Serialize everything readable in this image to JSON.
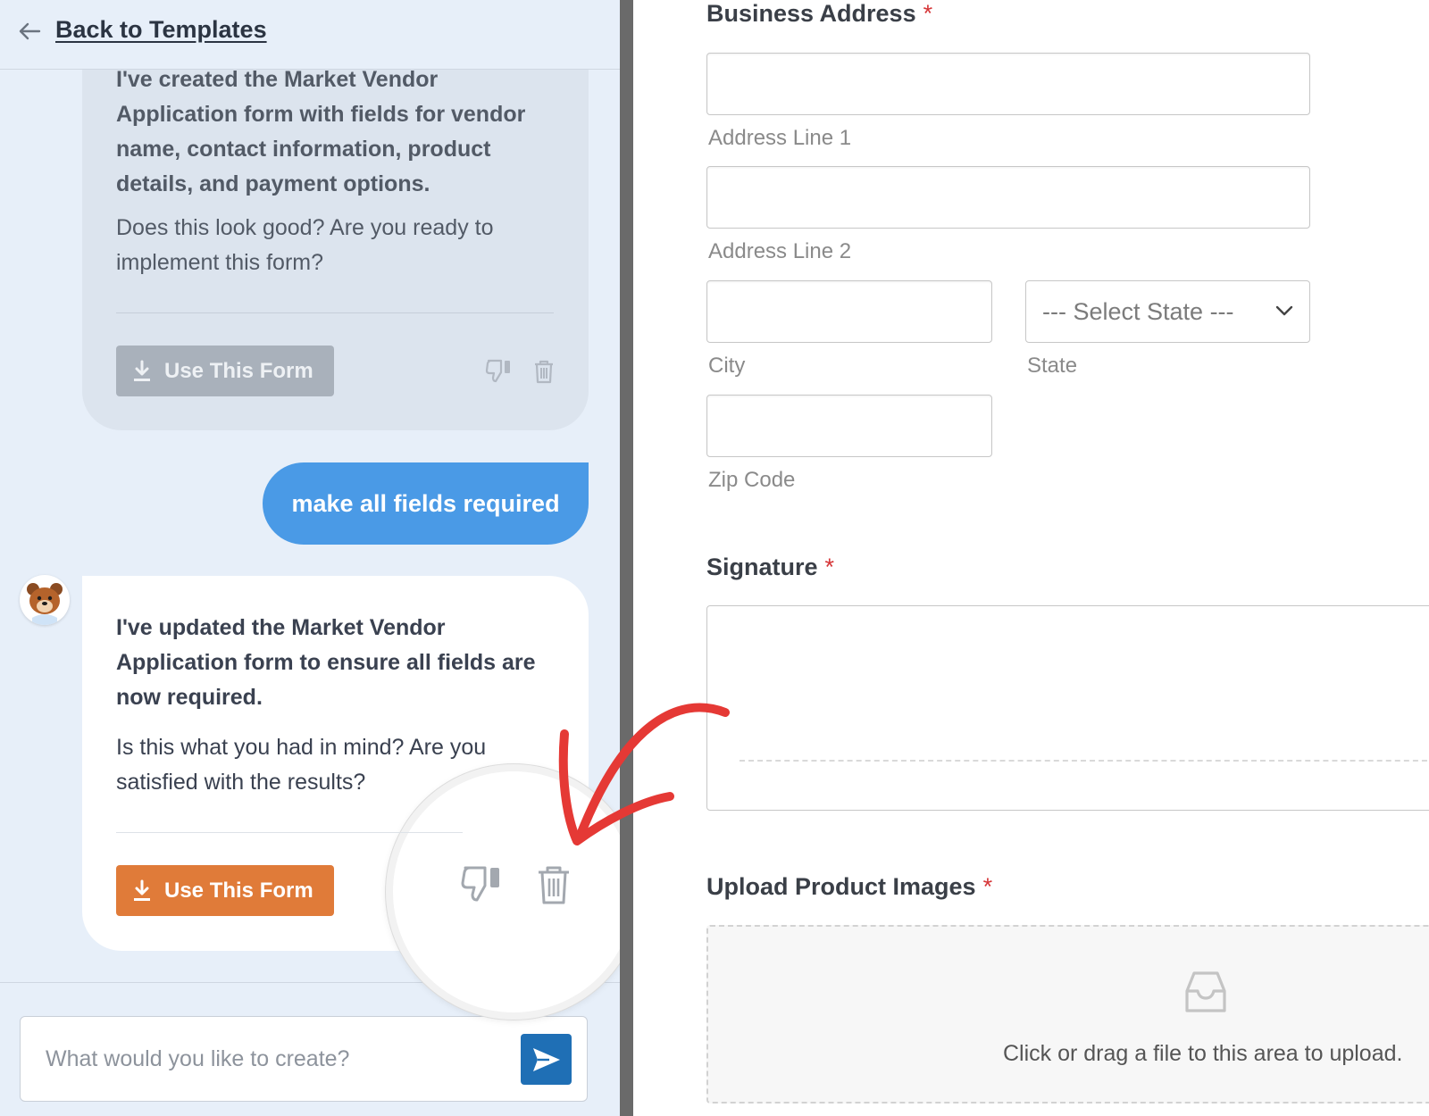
{
  "header": {
    "back_label": "Back to Templates"
  },
  "chat": {
    "previous_message": {
      "bold_text": "I've created the Market Vendor Application form with fields for vendor name, contact information, product details, and payment options.",
      "text": "Does this look good? Are you ready to implement this form?",
      "button_label": "Use This Form"
    },
    "user_message": "make all fields required",
    "latest_message": {
      "bold_text": "I've updated the Market Vendor Application form to ensure all fields are now required.",
      "text": "Is this what you had in mind? Are you satisfied with the results?",
      "button_label": "Use This Form"
    },
    "input": {
      "placeholder": "What would you like to create?"
    },
    "icons": {
      "back": "arrow-left-icon",
      "download": "download-icon",
      "dislike": "thumbs-down-icon",
      "delete": "trash-icon",
      "send": "send-icon",
      "avatar": "bear-mascot-avatar"
    }
  },
  "form": {
    "business_address": {
      "label": "Business Address",
      "required_marker": "*",
      "address_line_1": "Address Line 1",
      "address_line_2": "Address Line 2",
      "city": "City",
      "state": "State",
      "state_selected": "--- Select State ---",
      "zip": "Zip Code"
    },
    "signature": {
      "label": "Signature",
      "required_marker": "*"
    },
    "upload": {
      "label": "Upload Product Images",
      "required_marker": "*",
      "hint": "Click or drag a file to this area to upload.",
      "icon": "inbox-icon"
    }
  },
  "colors": {
    "use_form_button": "#e07b39",
    "user_bubble": "#4a9ae6",
    "send_button": "#1f6fb5",
    "required_asterisk": "#d63638",
    "annotation_arrow": "#e53935",
    "chat_background": "#e7eff9"
  }
}
